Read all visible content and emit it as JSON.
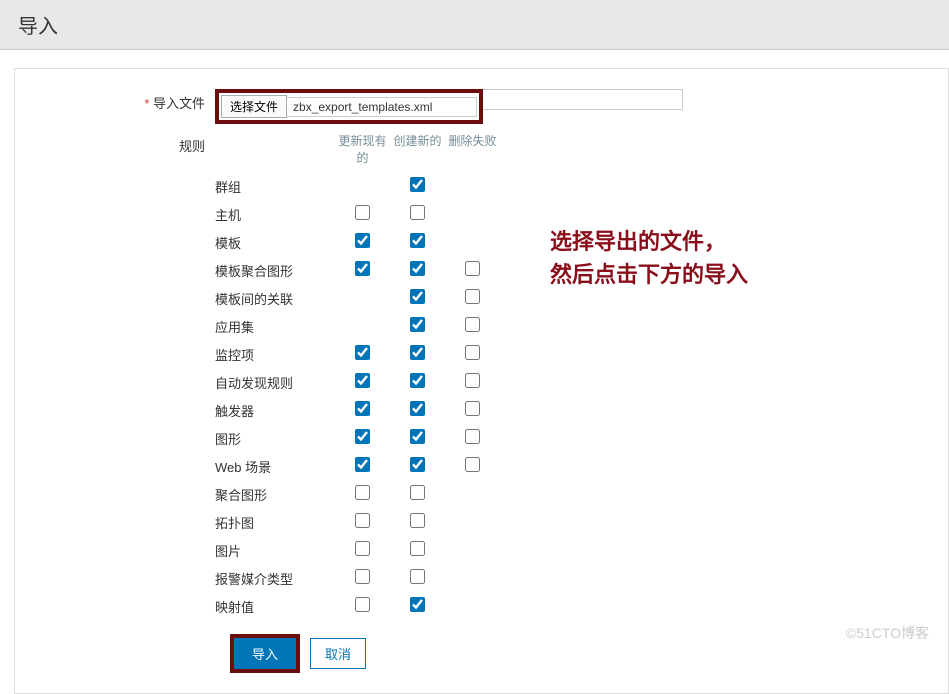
{
  "header": {
    "title": "导入"
  },
  "form": {
    "file_label": "导入文件",
    "choose_button": "选择文件",
    "file_name": "zbx_export_templates.xml",
    "rules_label": "规则"
  },
  "rules_headers": {
    "update": "更新现有的",
    "create": "创建新的",
    "delete": "删除失败"
  },
  "rules": [
    {
      "name": "群组",
      "cols": [
        null,
        true,
        null
      ]
    },
    {
      "name": "主机",
      "cols": [
        false,
        false,
        null
      ]
    },
    {
      "name": "模板",
      "cols": [
        true,
        true,
        null
      ]
    },
    {
      "name": "模板聚合图形",
      "cols": [
        true,
        true,
        false
      ]
    },
    {
      "name": "模板间的关联",
      "cols": [
        null,
        true,
        false
      ]
    },
    {
      "name": "应用集",
      "cols": [
        null,
        true,
        false
      ]
    },
    {
      "name": "监控项",
      "cols": [
        true,
        true,
        false
      ]
    },
    {
      "name": "自动发现规则",
      "cols": [
        true,
        true,
        false
      ]
    },
    {
      "name": "触发器",
      "cols": [
        true,
        true,
        false
      ]
    },
    {
      "name": "图形",
      "cols": [
        true,
        true,
        false
      ]
    },
    {
      "name": "Web 场景",
      "cols": [
        true,
        true,
        false
      ]
    },
    {
      "name": "聚合图形",
      "cols": [
        false,
        false,
        null
      ]
    },
    {
      "name": "拓扑图",
      "cols": [
        false,
        false,
        null
      ]
    },
    {
      "name": "图片",
      "cols": [
        false,
        false,
        null
      ]
    },
    {
      "name": "报警媒介类型",
      "cols": [
        false,
        false,
        null
      ]
    },
    {
      "name": "映射值",
      "cols": [
        false,
        true,
        null
      ]
    }
  ],
  "buttons": {
    "import": "导入",
    "cancel": "取消"
  },
  "annotation": {
    "line1": "选择导出的文件，",
    "line2": "然后点击下方的导入"
  },
  "watermark": "©51CTO博客"
}
